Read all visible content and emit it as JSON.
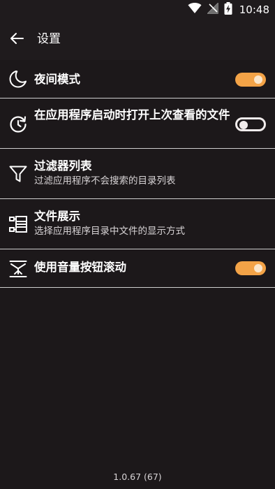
{
  "status_bar": {
    "time": "10:48",
    "icons": [
      "wifi-icon",
      "no-signal-icon",
      "battery-charging-icon"
    ]
  },
  "app_bar": {
    "back_icon": "arrow-back-icon",
    "title": "设置"
  },
  "settings": [
    {
      "icon": "moon-icon",
      "title": "夜间模式",
      "toggle": true,
      "enabled": true
    },
    {
      "icon": "restore-icon",
      "title": "在应用程序启动时打开上次查看的文件",
      "toggle": true,
      "enabled": false
    },
    {
      "icon": "filter-icon",
      "title": "过滤器列表",
      "subtitle": "过滤应用程序不会搜索的目录列表"
    },
    {
      "icon": "file-display-icon",
      "title": "文件展示",
      "subtitle": "选择应用程序目录中文件的显示方式"
    },
    {
      "icon": "volume-scroll-icon",
      "title": "使用音量按钮滚动",
      "toggle": true,
      "enabled": true
    }
  ],
  "version": "1.0.67 (67)",
  "colors": {
    "background": "#1c181a",
    "accent": "#f3a347",
    "divider": "#cfcfcf"
  }
}
